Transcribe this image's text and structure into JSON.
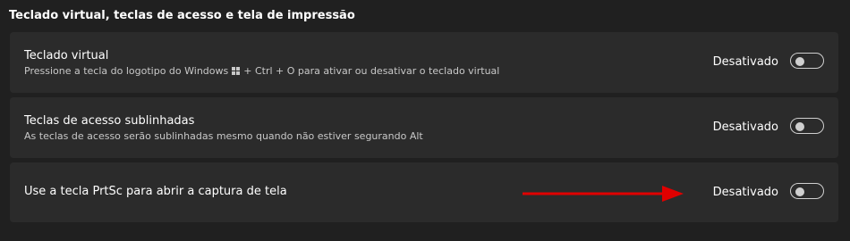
{
  "section": {
    "title": "Teclado virtual, teclas de acesso e tela de impressão"
  },
  "settings": [
    {
      "title": "Teclado virtual",
      "desc_before": "Pressione a tecla do logotipo do Windows",
      "desc_after": "+ Ctrl + O para ativar ou desativar o teclado virtual",
      "state": "Desativado",
      "on": false
    },
    {
      "title": "Teclas de acesso sublinhadas",
      "desc": "As teclas de acesso serão sublinhadas mesmo quando não estiver segurando Alt",
      "state": "Desativado",
      "on": false
    },
    {
      "title": "Use a tecla PrtSc para abrir a captura de tela",
      "state": "Desativado",
      "on": false
    }
  ],
  "colors": {
    "background": "#202020",
    "card": "#2b2b2b",
    "arrow": "#e00000"
  },
  "icons": {
    "windows_logo": "windows-logo-icon",
    "annotation_arrow": "red-arrow-icon"
  }
}
